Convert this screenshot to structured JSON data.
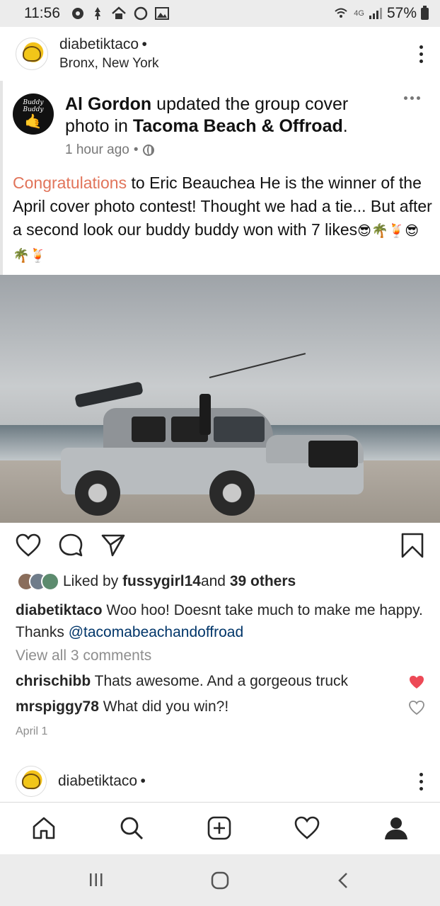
{
  "status_bar": {
    "time": "11:56",
    "network": "4G",
    "battery": "57%"
  },
  "post_header": {
    "username": "diabetiktaco",
    "separator": "•",
    "location": "Bronx, New York"
  },
  "shared_card": {
    "avatar_text_line1": "Buddy",
    "avatar_text_line2": "Buddy",
    "actor": "Al Gordon",
    "action": " updated the group cover photo in ",
    "group": "Tacoma Beach & Offroad",
    "period": ".",
    "time": "1 hour ago",
    "meta_sep": "•",
    "body_highlight": "Congratulations",
    "body_text": " to Eric Beauchea He is the winner of the April cover photo contest! Thought we had a tie... But after a second look our buddy buddy won with 7 likes",
    "body_emoji": "😎🌴🍹😎🌴🍹"
  },
  "likes": {
    "prefix": "Liked by ",
    "user": "fussygirl14",
    "middle": " and ",
    "others": "39 others"
  },
  "caption": {
    "username": "diabetiktaco",
    "text": " Woo hoo!  Doesnt take much to make me happy.  Thanks ",
    "mention": "@tacomabeachandoffroad"
  },
  "view_all_comments": "View all 3 comments",
  "comments": [
    {
      "username": "chrischibb",
      "text": " Thats awesome. And a gorgeous truck"
    },
    {
      "username": "mrspiggy78",
      "text": " What did you win?!"
    }
  ],
  "post_date": "April 1",
  "next_post": {
    "username": "diabetiktaco",
    "separator": "•"
  },
  "icons": {
    "home": "home-icon",
    "search": "search-icon",
    "add": "add-post-icon",
    "activity": "heart-icon",
    "profile": "profile-icon"
  },
  "colors": {
    "like_red": "#ed4956",
    "mention_blue": "#003569",
    "highlight_orange": "#e1745a"
  }
}
